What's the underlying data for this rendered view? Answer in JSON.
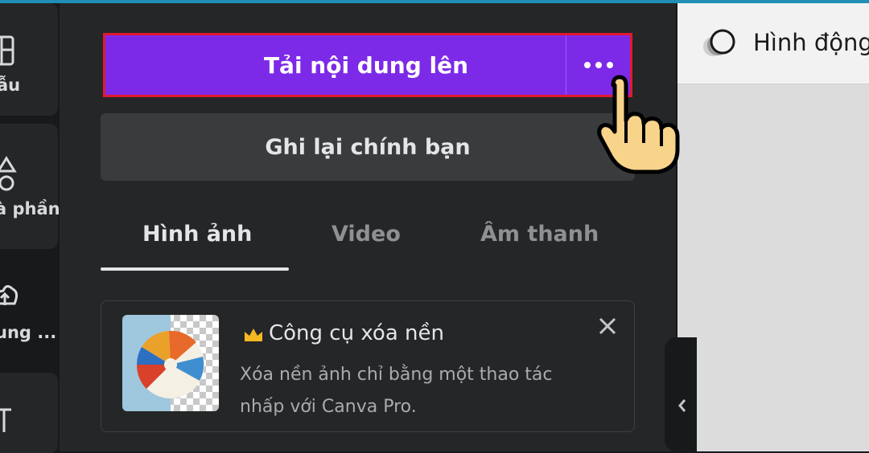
{
  "rail": {
    "items": [
      {
        "label": "ẫu",
        "icon": "layout-icon"
      },
      {
        "label": "à phần",
        "icon": "shapes-icon"
      },
      {
        "label": "ung ...",
        "icon": "cloud-upload-icon"
      },
      {
        "label": "",
        "icon": "text-icon"
      }
    ]
  },
  "panel": {
    "upload_label": "Tải nội dung lên",
    "more_icon": "more-dots-icon",
    "record_label": "Ghi lại chính bạn",
    "tabs": [
      {
        "label": "Hình ảnh",
        "active": true
      },
      {
        "label": "Video",
        "active": false
      },
      {
        "label": "Âm thanh",
        "active": false
      }
    ],
    "promo": {
      "title": "Công cụ xóa nền",
      "description": "Xóa nền ảnh chỉ bằng một thao tác nhấp với Canva Pro.",
      "badge_icon": "crown-icon",
      "close_icon": "close-icon",
      "thumbnail": "beach-ball-image"
    },
    "collapse_icon": "chevron-left-icon"
  },
  "canvas": {
    "animation_label": "Hình động",
    "animation_icon": "animate-icon"
  },
  "cursor": "pointing-hand-icon",
  "colors": {
    "accent": "#7d2ae8",
    "highlight": "#e0192f",
    "panel_bg": "#252627",
    "rail_bg": "#18191b"
  }
}
